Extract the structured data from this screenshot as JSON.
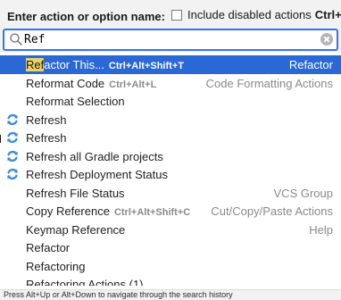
{
  "header": {
    "title": "Enter action or option name:",
    "checkbox_label": "Include disabled actions",
    "checkbox_shortcut": "Ctrl+Shift+A",
    "checkbox_checked": false
  },
  "search": {
    "value": "Ref"
  },
  "items": [
    {
      "highlight": "Ref",
      "rest": "actor This...",
      "shortcut": "Ctrl+Alt+Shift+T",
      "group": "Refactor",
      "icon": ""
    },
    {
      "label": "Reformat Code",
      "shortcut": "Ctrl+Alt+L",
      "group": "Code Formatting Actions",
      "icon": ""
    },
    {
      "label": "Reformat Selection",
      "shortcut": "",
      "group": "",
      "icon": ""
    },
    {
      "label": "Refresh",
      "shortcut": "",
      "group": "",
      "icon": "refresh-icon"
    },
    {
      "label": "Refresh",
      "shortcut": "",
      "group": "",
      "icon": "refresh-icon"
    },
    {
      "label": "Refresh all Gradle projects",
      "shortcut": "",
      "group": "",
      "icon": "refresh-icon"
    },
    {
      "label": "Refresh Deployment Status",
      "shortcut": "",
      "group": "",
      "icon": "refresh-icon"
    },
    {
      "label": "Refresh File Status",
      "shortcut": "",
      "group": "VCS Group",
      "icon": ""
    },
    {
      "label": "Copy Reference",
      "shortcut": "Ctrl+Alt+Shift+C",
      "group": "Cut/Copy/Paste Actions",
      "icon": ""
    },
    {
      "label": "Keymap Reference",
      "shortcut": "",
      "group": "Help",
      "icon": ""
    },
    {
      "label": "Refactor",
      "shortcut": "",
      "group": "",
      "icon": ""
    },
    {
      "label": "Refactoring",
      "shortcut": "",
      "group": "",
      "icon": ""
    },
    {
      "label": "Refactoring Actions (1)",
      "shortcut": "",
      "group": "",
      "icon": ""
    }
  ],
  "footer": {
    "hint": "Press Alt+Up or Alt+Down to navigate through the search history"
  },
  "colors": {
    "selection": "#2a68d6",
    "focus_border": "#3574f0",
    "match_highlight": "#e9d36a"
  }
}
